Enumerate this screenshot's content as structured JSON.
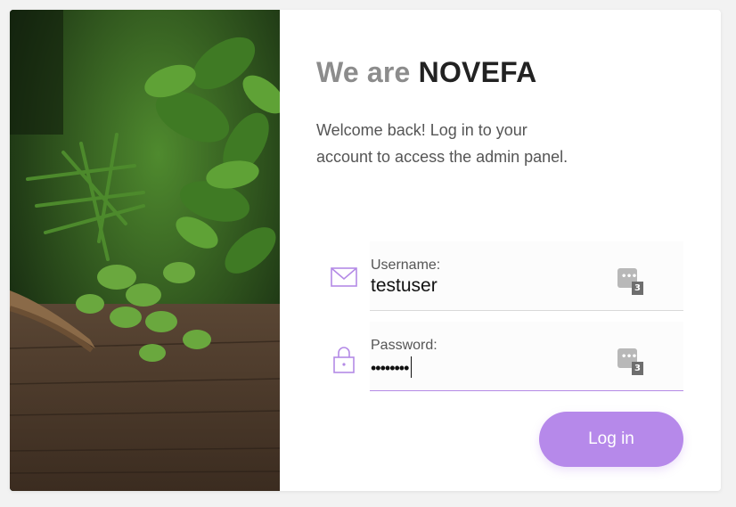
{
  "brand": {
    "prefix": "We are",
    "name": "NOVEFA"
  },
  "welcome_text": "Welcome back! Log in to your account to access the admin panel.",
  "form": {
    "username": {
      "label": "Username:",
      "value": "testuser",
      "icon": "mail-icon",
      "password_manager_count": "3"
    },
    "password": {
      "label": "Password:",
      "masked_value": "••••••••",
      "icon": "lock-icon",
      "password_manager_count": "3"
    },
    "login_label": "Log in"
  },
  "colors": {
    "accent": "#b689ea",
    "brand_prefix": "#8c8c8c",
    "brand_name": "#222222"
  }
}
